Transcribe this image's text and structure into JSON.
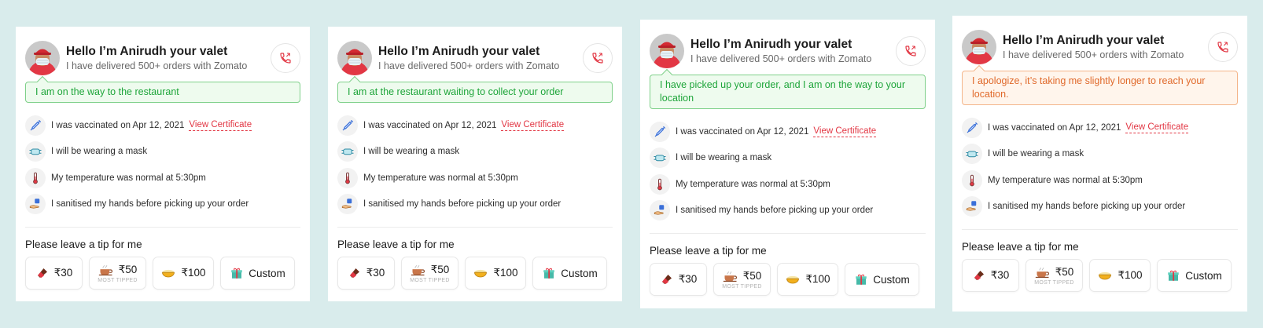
{
  "cards": [
    {
      "valet_title": "Hello I’m Anirudh your valet",
      "valet_sub": "I have delivered 500+ orders with Zomato",
      "status": "I am on the way to the restaurant",
      "status_tone": "green"
    },
    {
      "valet_title": "Hello I’m Anirudh your valet",
      "valet_sub": "I have delivered 500+ orders with Zomato",
      "status": "I am at the restaurant waiting to collect your order",
      "status_tone": "green"
    },
    {
      "valet_title": "Hello I’m Anirudh your valet",
      "valet_sub": "I have delivered 500+ orders with Zomato",
      "status": "I have picked up your order, and I am on the way to your location",
      "status_tone": "green"
    },
    {
      "valet_title": "Hello I’m Anirudh your valet",
      "valet_sub": "I have delivered 500+ orders with Zomato",
      "status": "I apologize, it’s taking me slightly longer to reach your location.",
      "status_tone": "orange"
    }
  ],
  "safety": {
    "vaccinated": "I was vaccinated on Apr 12, 2021",
    "certificate_link": "View Certificate",
    "mask": "I will be wearing a mask",
    "temperature": "My temperature was normal at 5:30pm",
    "sanitised": "I sanitised my hands before picking up your order"
  },
  "tip": {
    "heading": "Please leave a tip for me",
    "options": [
      {
        "label": "₹30",
        "icon": "chocolate-icon"
      },
      {
        "label": "₹50",
        "icon": "coffee-icon",
        "note": "MOST TIPPED"
      },
      {
        "label": "₹100",
        "icon": "food-bowl-icon"
      },
      {
        "label": "Custom",
        "icon": "gift-icon"
      }
    ]
  },
  "colors": {
    "accent_red": "#e23744",
    "status_green": "#1ea53a",
    "status_orange": "#e0692a",
    "background": "#d9ecec"
  }
}
